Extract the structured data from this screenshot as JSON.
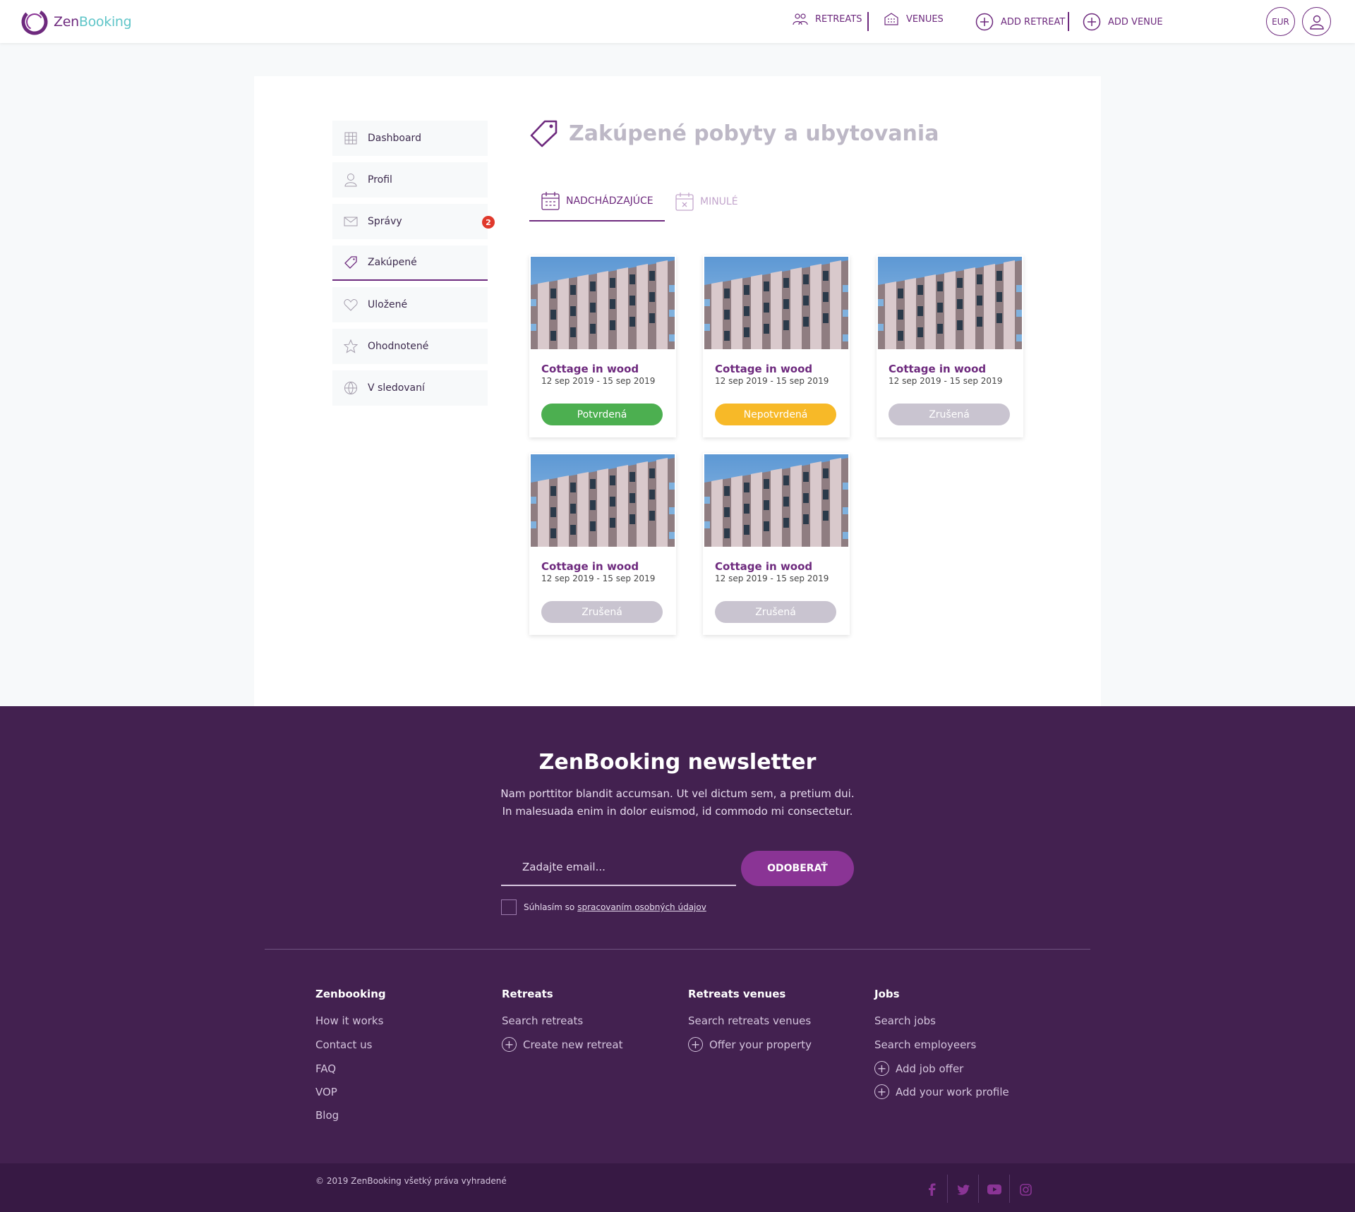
{
  "brand": {
    "zen": "Zen",
    "booking": "Booking"
  },
  "nav": {
    "retreats": "RETREATS",
    "venues": "VENUES",
    "add_retreat": "ADD RETREAT",
    "add_venue": "ADD VENUE",
    "currency": "EUR"
  },
  "sidebar": {
    "items": [
      {
        "label": "Dashboard",
        "icon": "grid-icon"
      },
      {
        "label": "Profil",
        "icon": "user-icon"
      },
      {
        "label": "Správy",
        "icon": "envelope-icon",
        "badge": "2"
      },
      {
        "label": "Zakúpené",
        "icon": "tag-icon",
        "active": true
      },
      {
        "label": "Uložené",
        "icon": "heart-icon"
      },
      {
        "label": "Ohodnotené",
        "icon": "star-icon"
      },
      {
        "label": "V sledovaní",
        "icon": "globe-icon"
      }
    ]
  },
  "page": {
    "title": "Zakúpené pobyty a ubytovania"
  },
  "tabs": [
    {
      "label": "NADCHÁDZAJÚCE",
      "active": true
    },
    {
      "label": "MINULÉ",
      "active": false
    }
  ],
  "bookings": [
    {
      "title": "Cottage in wood",
      "dates": "12 sep 2019 - 15 sep 2019",
      "status": "Potvrdená",
      "status_color": "#4caf50"
    },
    {
      "title": "Cottage in wood",
      "dates": "12 sep 2019 - 15 sep 2019",
      "status": "Nepotvrdená",
      "status_color": "#f7b928"
    },
    {
      "title": "Cottage in wood",
      "dates": "12 sep 2019 - 15 sep 2019",
      "status": "Zrušená",
      "status_color": "#c9c4d0"
    },
    {
      "title": "Cottage in wood",
      "dates": "12 sep 2019 - 15 sep 2019",
      "status": "Zrušená",
      "status_color": "#c9c4d0"
    },
    {
      "title": "Cottage in wood",
      "dates": "12 sep 2019 - 15 sep 2019",
      "status": "Zrušená",
      "status_color": "#c9c4d0"
    }
  ],
  "newsletter": {
    "title": "ZenBooking newsletter",
    "line1": "Nam porttitor blandit accumsan. Ut vel dictum sem, a pretium dui.",
    "line2": "In malesuada enim in dolor euismod, id commodo mi consectetur.",
    "email_placeholder": "Zadajte email...",
    "subscribe": "ODOBERAŤ",
    "consent_prefix": "Súhlasím so",
    "consent_link": "spracovaním osobných údajov"
  },
  "footer": {
    "columns": [
      {
        "title": "Zenbooking",
        "links": [
          {
            "label": "How it works"
          },
          {
            "label": "Contact us"
          },
          {
            "label": "FAQ"
          },
          {
            "label": "VOP"
          },
          {
            "label": "Blog"
          }
        ]
      },
      {
        "title": "Retreats",
        "links": [
          {
            "label": "Search retreats"
          },
          {
            "label": "Create new retreat",
            "plus": true
          }
        ]
      },
      {
        "title": "Retreats venues",
        "links": [
          {
            "label": "Search retreats venues"
          },
          {
            "label": "Offer your property",
            "plus": true
          }
        ]
      },
      {
        "title": "Jobs",
        "links": [
          {
            "label": "Search jobs"
          },
          {
            "label": "Search employeers"
          },
          {
            "label": "Add job offer",
            "plus": true
          },
          {
            "label": "Add your work profile",
            "plus": true
          }
        ]
      }
    ],
    "copyright": "© 2019 ZenBooking všetký práva vyhradené",
    "social": [
      "facebook-icon",
      "twitter-icon",
      "youtube-icon",
      "instagram-icon"
    ]
  },
  "colors": {
    "brand_purple": "#6e2a7e",
    "teal": "#5fc5c8",
    "footer_bg": "#432150"
  }
}
